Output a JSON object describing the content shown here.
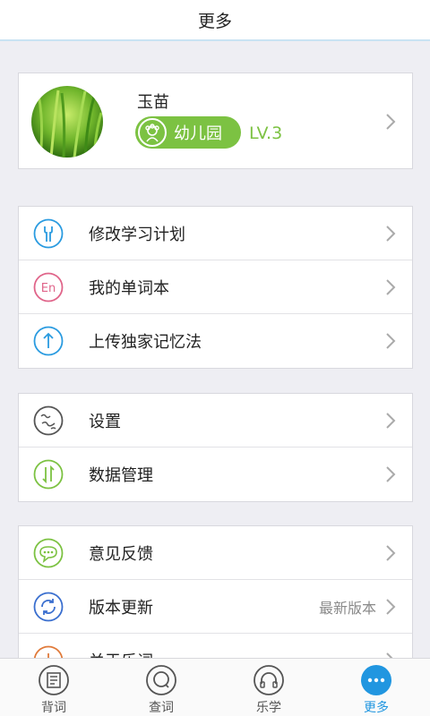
{
  "header": {
    "title": "更多"
  },
  "profile": {
    "username": "玉苗",
    "badge_label": "幼儿园",
    "level": "LV.3",
    "colors": {
      "badge": "#7cc242"
    }
  },
  "groups": [
    {
      "items": [
        {
          "label": "修改学习计划",
          "icon": "wrench-icon",
          "color": "#2a9be0"
        },
        {
          "label": "我的单词本",
          "icon": "en-icon",
          "color": "#e0658a"
        },
        {
          "label": "上传独家记忆法",
          "icon": "upload-arrow-icon",
          "color": "#2a9be0"
        }
      ]
    },
    {
      "items": [
        {
          "label": "设置",
          "icon": "settings-icon",
          "color": "#555555"
        },
        {
          "label": "数据管理",
          "icon": "data-sync-icon",
          "color": "#7cc242"
        }
      ]
    },
    {
      "items": [
        {
          "label": "意见反馈",
          "icon": "chat-bubble-icon",
          "color": "#7cc242"
        },
        {
          "label": "版本更新",
          "icon": "refresh-icon",
          "color": "#3a6fcf",
          "extra": "最新版本"
        },
        {
          "label": "关于乐词",
          "icon": "info-icon",
          "color": "#e07a3a"
        }
      ]
    }
  ],
  "tabs": [
    {
      "label": "背词",
      "icon": "book-icon",
      "active": false
    },
    {
      "label": "查词",
      "icon": "search-icon",
      "active": false
    },
    {
      "label": "乐学",
      "icon": "headphones-icon",
      "active": false
    },
    {
      "label": "更多",
      "icon": "more-dots-icon",
      "active": true
    }
  ],
  "colors": {
    "accent": "#2196e0",
    "background": "#eeeef3"
  }
}
